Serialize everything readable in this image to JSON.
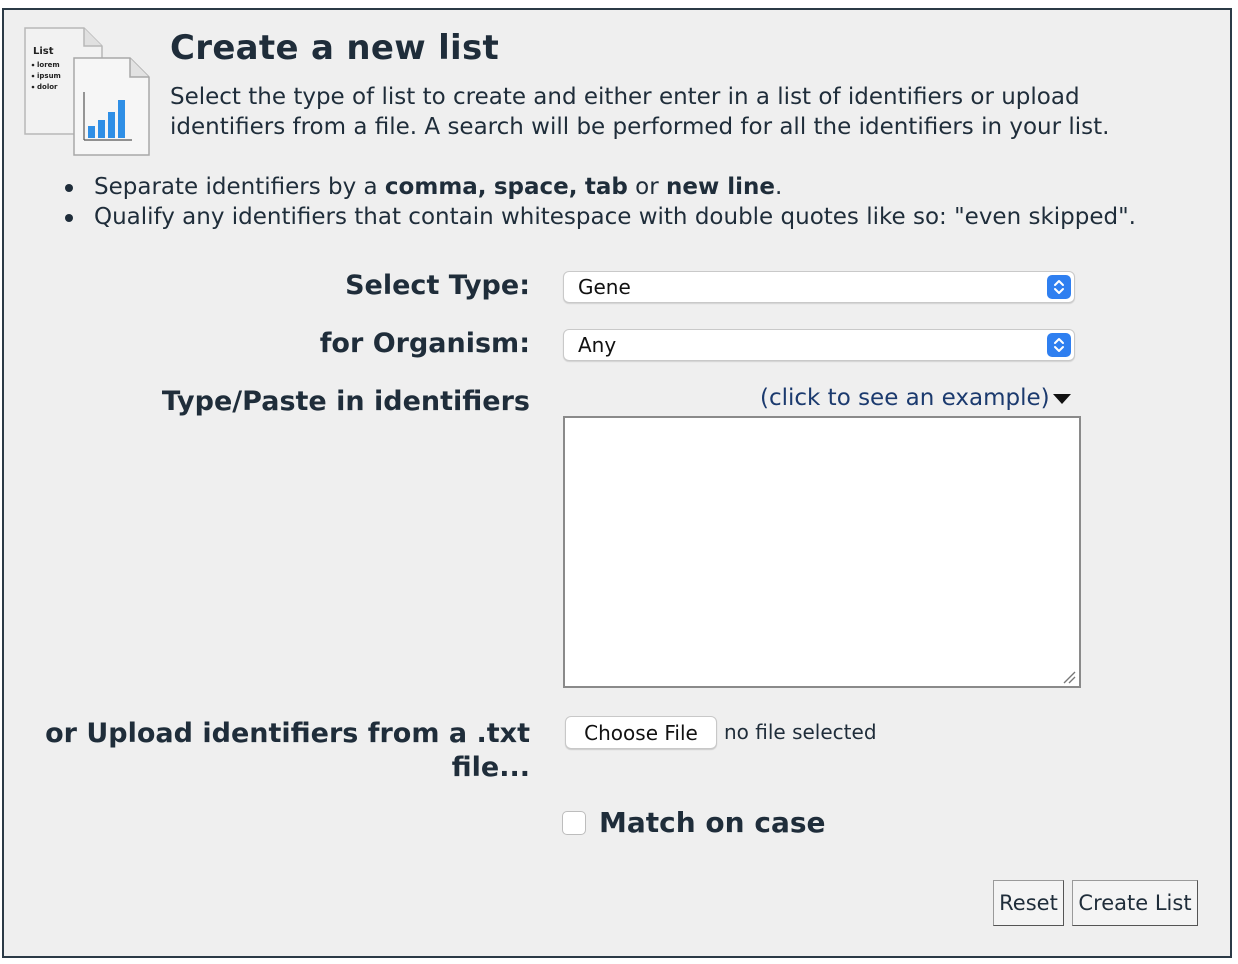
{
  "header": {
    "title": "Create a new list",
    "intro": "Select the type of list to create and either enter in a list of identifiers or upload identifiers from a file. A search will be performed for all the identifiers in your list.",
    "icon_text": [
      "List",
      "lorem",
      "ipsum",
      "dolor"
    ]
  },
  "tips": {
    "separate": {
      "prefix": "Separate identifiers by a ",
      "comma": "comma,",
      "space": "space,",
      "tab": "tab",
      "or": "or",
      "newline": "new line",
      "period": "."
    },
    "qualify": "Qualify any identifiers that contain whitespace with double quotes like so: \"even skipped\"."
  },
  "form": {
    "select_type_label": "Select Type:",
    "select_type_value": "Gene",
    "organism_label": "for Organism:",
    "organism_value": "Any",
    "paste_label": "Type/Paste in identifiers",
    "example_link": "(click to see an example)",
    "identifiers_value": "",
    "upload_label": "or Upload identifiers from a .txt file...",
    "choose_file_label": "Choose File",
    "file_status": "no file selected",
    "match_case_label": "Match on case",
    "match_case_checked": false
  },
  "actions": {
    "reset_label": "Reset",
    "create_label": "Create List"
  },
  "colors": {
    "accent": "#2f7ff0",
    "link": "#1b3a6e",
    "text": "#1f2d3a",
    "panel_bg": "#efefef"
  },
  "icons": {
    "header_icon": "list-document-chart-icon",
    "select_arrows": "up-down-chevron-icon",
    "example_caret": "triangle-down-icon",
    "resize_grip": "resize-grip-icon"
  }
}
